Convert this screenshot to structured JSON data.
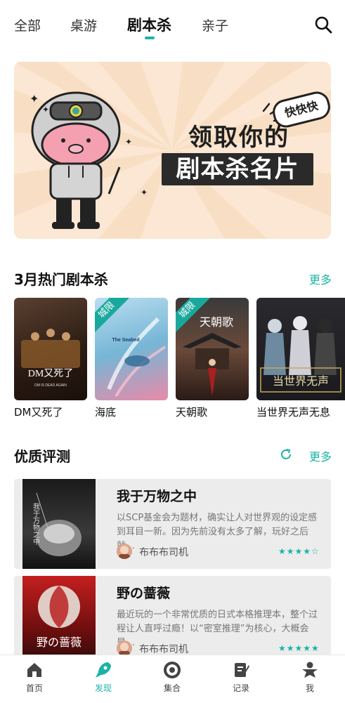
{
  "topnav": {
    "tabs": [
      {
        "label": "全部"
      },
      {
        "label": "桌游"
      },
      {
        "label": "剧本杀",
        "active": true
      },
      {
        "label": "亲子"
      }
    ]
  },
  "banner": {
    "title_line1": "领取你的",
    "title_line2": "剧本杀名片",
    "tag": "快快快"
  },
  "hot": {
    "title": "3月热门剧本杀",
    "more": "更多",
    "items": [
      {
        "label": "DM又死了",
        "cover_text": "DM又死了",
        "cover_sub": "DM IS DEAD AGAIN"
      },
      {
        "label": "海底",
        "tag": "城限",
        "cover_text": "The Seabed"
      },
      {
        "label": "天朝歌",
        "tag": "城限",
        "cover_text": "天朝歌"
      },
      {
        "label": "当世界无声无息",
        "cover_text": "当世界无声"
      }
    ]
  },
  "reviews": {
    "title": "优质评测",
    "more": "更多",
    "items": [
      {
        "title": "我于万物之中",
        "desc": "以SCP基金会为题材，确实让人对世界观的设定感到耳目一新。因为先前没有太多了解，玩好之后就…",
        "author": "布布布司机",
        "stars": "★★★★☆",
        "cover_text": "我于万物之中"
      },
      {
        "title": "野の蔷薇",
        "desc": "最近玩的一个非常优质的日式本格推理本，整个过程让人直呼过瘾！以“密室推理”为核心，大概会是…",
        "author": "布布布司机",
        "stars": "★★★★★",
        "cover_text": "野の蔷薇"
      }
    ]
  },
  "bottom_nav": {
    "items": [
      {
        "label": "首页",
        "icon": "home-icon"
      },
      {
        "label": "发现",
        "icon": "rocket-icon",
        "active": true
      },
      {
        "label": "集合",
        "icon": "circle-icon"
      },
      {
        "label": "记录",
        "icon": "note-icon"
      },
      {
        "label": "我",
        "icon": "meeple-icon"
      }
    ]
  },
  "colors": {
    "accent": "#19b3a8",
    "banner_bg": "#fbe7d3"
  }
}
